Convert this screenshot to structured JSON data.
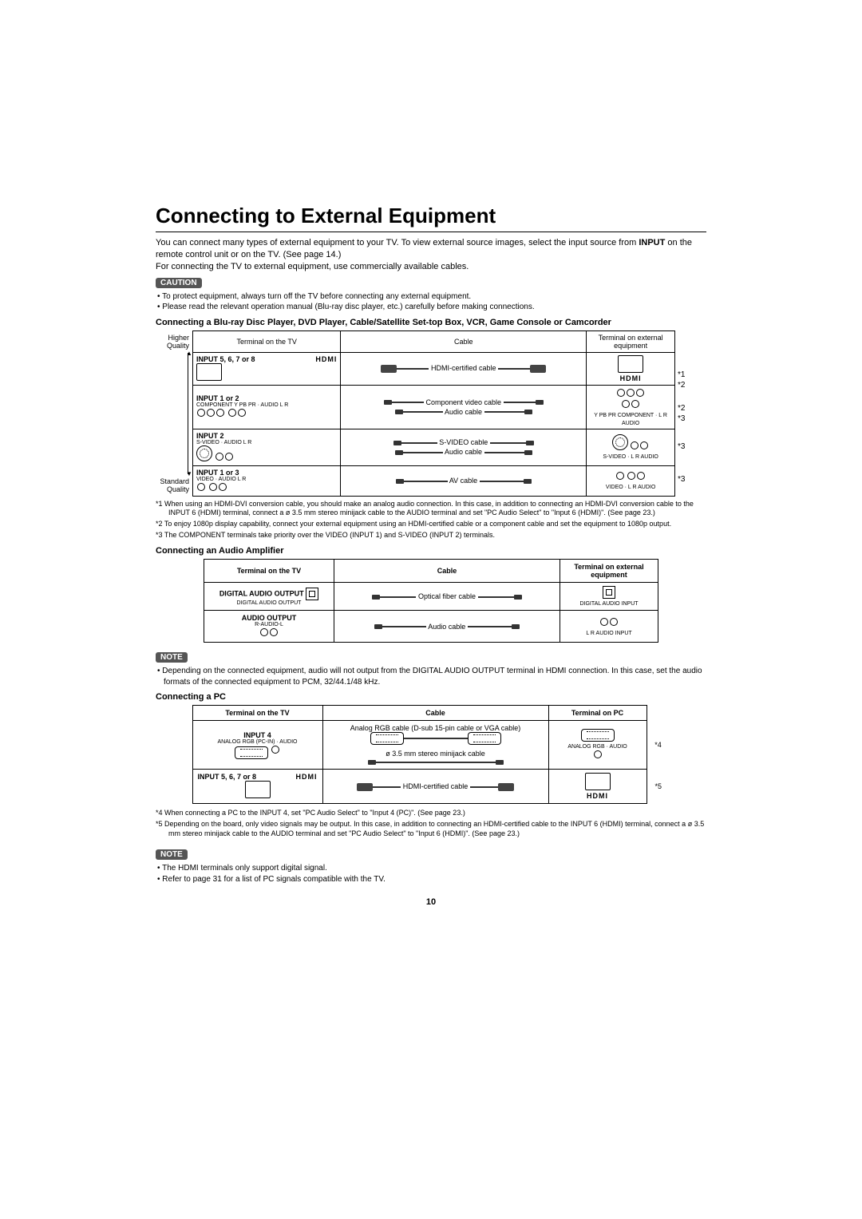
{
  "title": "Connecting to External Equipment",
  "intro": {
    "p1a": "You can connect many types of external equipment to your TV. To view external source images, select the input source from ",
    "p1b": "INPUT",
    "p1c": " on the remote control unit or on the TV. (See page 14.)",
    "p2": "For connecting the TV to external equipment, use commercially available cables."
  },
  "caution_label": "CAUTION",
  "caution_items": [
    "To protect equipment, always turn off the TV before connecting any external equipment.",
    "Please read the relevant operation manual (Blu-ray disc player, etc.) carefully before making connections."
  ],
  "main_section": "Connecting a Blu-ray Disc Player, DVD Player, Cable/Satellite Set-top Box, VCR, Game Console or Camcorder",
  "quality_high": "Higher Quality",
  "quality_low": "Standard Quality",
  "headers": {
    "tv": "Terminal on the TV",
    "cable": "Cable",
    "ext": "Terminal on external equipment",
    "pc_ext": "Terminal on PC"
  },
  "rows": [
    {
      "input": "INPUT 5, 6, 7 or 8",
      "term_labels": "",
      "logo": "HDMI",
      "cables": [
        "HDMI-certified cable"
      ],
      "ext_label": "HDMI",
      "notes": [
        "*1",
        "*2"
      ]
    },
    {
      "input": "INPUT 1 or 2",
      "term_labels": "COMPONENT Y PB PR · AUDIO L R",
      "logo": "",
      "cables": [
        "Component video cable",
        "Audio cable"
      ],
      "ext_label": "Y PB PR COMPONENT · L R AUDIO",
      "notes": [
        "*2",
        "*3"
      ]
    },
    {
      "input": "INPUT 2",
      "term_labels": "S-VIDEO · AUDIO L R",
      "logo": "",
      "cables": [
        "S-VIDEO cable",
        "Audio cable"
      ],
      "ext_label": "S-VIDEO · L R AUDIO",
      "notes": [
        "*3"
      ]
    },
    {
      "input": "INPUT 1 or 3",
      "term_labels": "VIDEO · AUDIO L R",
      "logo": "",
      "cables": [
        "AV cable"
      ],
      "ext_label": "VIDEO · L R AUDIO",
      "notes": [
        "*3"
      ]
    }
  ],
  "footnotes_main": [
    "*1  When using an HDMI-DVI conversion cable, you should make an analog audio connection. In this case, in addition to connecting an HDMI-DVI conversion cable to the INPUT 6 (HDMI) terminal, connect a ø 3.5 mm stereo minijack cable to the AUDIO terminal and set \"PC Audio Select\" to \"Input 6 (HDMI)\". (See page 23.)",
    "*2  To enjoy 1080p display capability, connect your external equipment using an HDMI-certified cable or a component cable and set the equipment to 1080p output.",
    "*3  The COMPONENT terminals take priority over the VIDEO (INPUT 1) and S-VIDEO (INPUT 2) terminals."
  ],
  "amp_section": "Connecting an Audio Amplifier",
  "amp_rows": [
    {
      "input": "DIGITAL AUDIO OUTPUT",
      "term_labels": "DIGITAL AUDIO OUTPUT",
      "cables": [
        "Optical fiber cable"
      ],
      "ext_label": "DIGITAL AUDIO INPUT"
    },
    {
      "input": "AUDIO OUTPUT",
      "term_labels": "R-AUDIO-L",
      "cables": [
        "Audio cable"
      ],
      "ext_label": "L R AUDIO INPUT"
    }
  ],
  "note_label": "NOTE",
  "amp_note": "Depending on the connected equipment, audio will not output from the DIGITAL AUDIO OUTPUT terminal in HDMI connection. In this case, set the audio formats of the connected equipment to PCM, 32/44.1/48 kHz.",
  "pc_section": "Connecting a PC",
  "pc_rows": [
    {
      "input": "INPUT 4",
      "term_labels": "ANALOG RGB (PC-IN) · AUDIO",
      "cables": [
        "Analog RGB cable (D-sub 15-pin cable or VGA cable)",
        "ø 3.5 mm stereo minijack cable"
      ],
      "ext_label": "ANALOG RGB · AUDIO",
      "notes": [
        "*4"
      ]
    },
    {
      "input": "INPUT 5, 6, 7 or 8",
      "term_labels": "",
      "logo": "HDMI",
      "cables": [
        "HDMI-certified cable"
      ],
      "ext_label": "HDMI",
      "notes": [
        "*5"
      ]
    }
  ],
  "footnotes_pc": [
    "*4  When connecting a PC to the INPUT 4, set \"PC Audio Select\" to \"Input 4 (PC)\". (See page 23.)",
    "*5  Depending on the board, only video signals may be output. In this case, in addition to connecting an HDMI-certified cable to the INPUT 6 (HDMI) terminal, connect a ø 3.5 mm stereo minijack cable to the AUDIO terminal and set \"PC Audio Select\" to \"Input 6 (HDMI)\". (See page 23.)"
  ],
  "pc_notes": [
    "The HDMI terminals only support digital signal.",
    "Refer to page 31 for a list of PC signals compatible with the TV."
  ],
  "page_number": "10"
}
